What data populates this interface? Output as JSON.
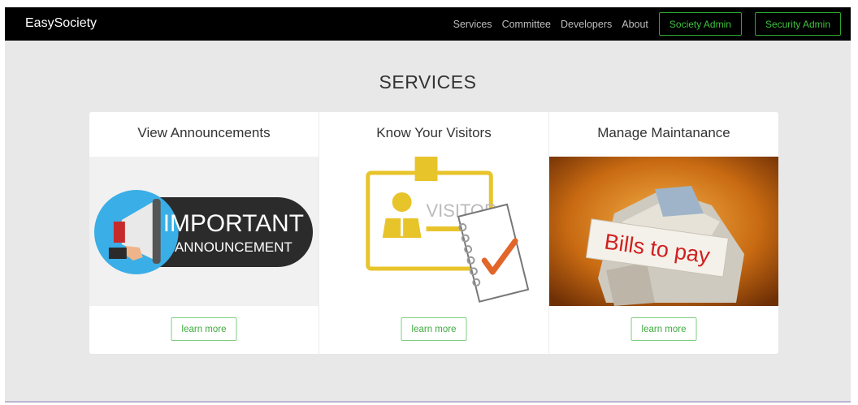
{
  "navbar": {
    "brand": "EasySociety",
    "links": [
      "Services",
      "Committee",
      "Developers",
      "About"
    ],
    "buttons": [
      "Society Admin",
      "Security Admin"
    ]
  },
  "page": {
    "title": "SERVICES"
  },
  "cards": [
    {
      "title": "View Announcements",
      "image_text": [
        "IMPORTANT",
        "ANNOUNCEMENT"
      ],
      "button": "learn more"
    },
    {
      "title": "Know Your Visitors",
      "image_text": [
        "VISITOR"
      ],
      "button": "learn more"
    },
    {
      "title": "Manage Maintanance",
      "image_text": [
        "Bills to pay"
      ],
      "button": "learn more"
    }
  ],
  "colors": {
    "navbar_bg": "#000000",
    "accent_green": "#3fc23f",
    "page_bg": "#e8e8e8"
  },
  "icons": [
    "megaphone-icon",
    "visitor-badge-icon",
    "checkmark-icon",
    "bills-pile-icon"
  ]
}
